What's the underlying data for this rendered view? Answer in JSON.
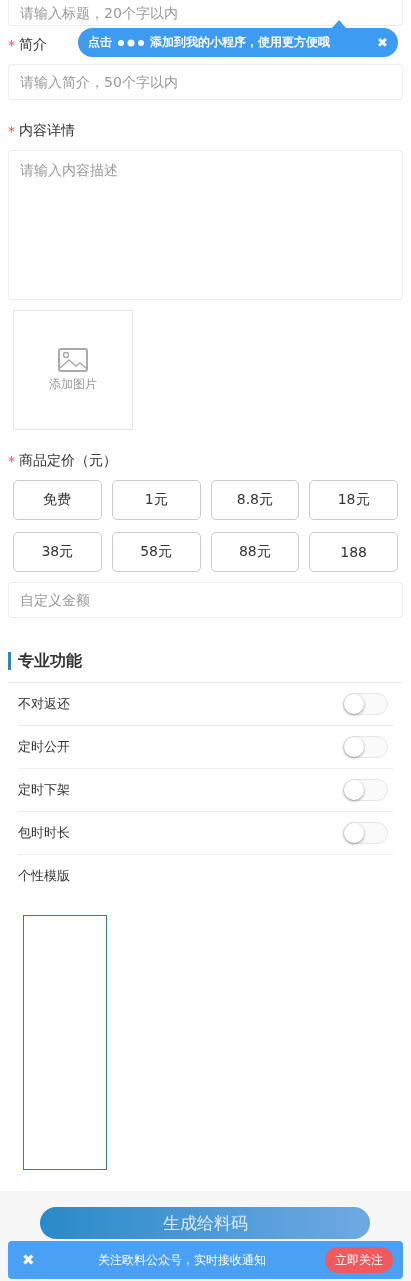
{
  "title_field": {
    "placeholder": "请输入标题，20个字以内"
  },
  "tooltip": {
    "prefix": "点击",
    "text": "添加到我的小程序，使用更方便哦",
    "close": "✖"
  },
  "summary": {
    "required_mark": "*",
    "label": "简介",
    "placeholder": "请输入简介，50个字以内"
  },
  "details": {
    "required_mark": "*",
    "label": "内容详情",
    "placeholder": "请输入内容描述"
  },
  "image_upload": {
    "label": "添加图片"
  },
  "pricing": {
    "required_mark": "*",
    "label": "商品定价（元）",
    "options": [
      {
        "label": "免费",
        "selected": false
      },
      {
        "label": "1元",
        "selected": false
      },
      {
        "label": "8.8元",
        "selected": false
      },
      {
        "label": "18元",
        "selected": false
      },
      {
        "label": "38元",
        "selected": false
      },
      {
        "label": "58元",
        "selected": false
      },
      {
        "label": "88元",
        "selected": false
      },
      {
        "label": "188",
        "selected": false
      }
    ],
    "custom_placeholder": "自定义金额"
  },
  "pro_features": {
    "title": "专业功能",
    "items": [
      {
        "kind": "toggle",
        "label": "不对返还",
        "on": false
      },
      {
        "kind": "toggle",
        "label": "定时公开",
        "on": false
      },
      {
        "kind": "toggle",
        "label": "定时下架",
        "on": false
      },
      {
        "kind": "toggle",
        "label": "包时时长",
        "on": false
      },
      {
        "kind": "text",
        "label": "个性模版"
      }
    ]
  },
  "generate_button": {
    "label": "生成给料码"
  },
  "follow_banner": {
    "close": "✖",
    "text": "关注欧料公众号，实时接收通知",
    "button": "立即关注"
  }
}
